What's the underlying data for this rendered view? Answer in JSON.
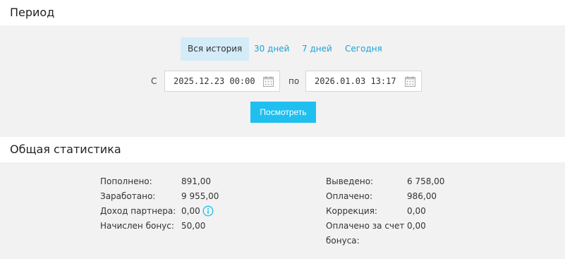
{
  "period": {
    "title": "Период",
    "tabs": [
      {
        "label": "Вся история"
      },
      {
        "label": "30 дней"
      },
      {
        "label": "7 дней"
      },
      {
        "label": "Сегодня"
      }
    ],
    "from_label": "С",
    "from_value": "2025.12.23 00:00",
    "to_label": "по",
    "to_value": "2026.01.03 13:17",
    "view_button": "Посмотреть"
  },
  "stats": {
    "title": "Общая статистика",
    "left": [
      {
        "label": "Пополнено:",
        "value": "891,00"
      },
      {
        "label": "Заработано:",
        "value": "9 955,00"
      },
      {
        "label": "Доход партнера:",
        "value": "0,00"
      },
      {
        "label": "Начислен бонус:",
        "value": "50,00"
      }
    ],
    "right": [
      {
        "label": "Выведено:",
        "value": "6 758,00"
      },
      {
        "label": "Оплачено:",
        "value": "986,00"
      },
      {
        "label": "Коррекция:",
        "value": "0,00"
      },
      {
        "label": "Оплачено за счет",
        "label2": "бонуса:",
        "value": "0,00"
      }
    ]
  },
  "colors": {
    "accent": "#1fbff0",
    "link": "#1aa3d9",
    "active_tab_bg": "#d4ecf8",
    "panel_bg": "#f2f2f2"
  },
  "icons": {
    "calendar": "calendar-icon",
    "info": "info-icon"
  }
}
